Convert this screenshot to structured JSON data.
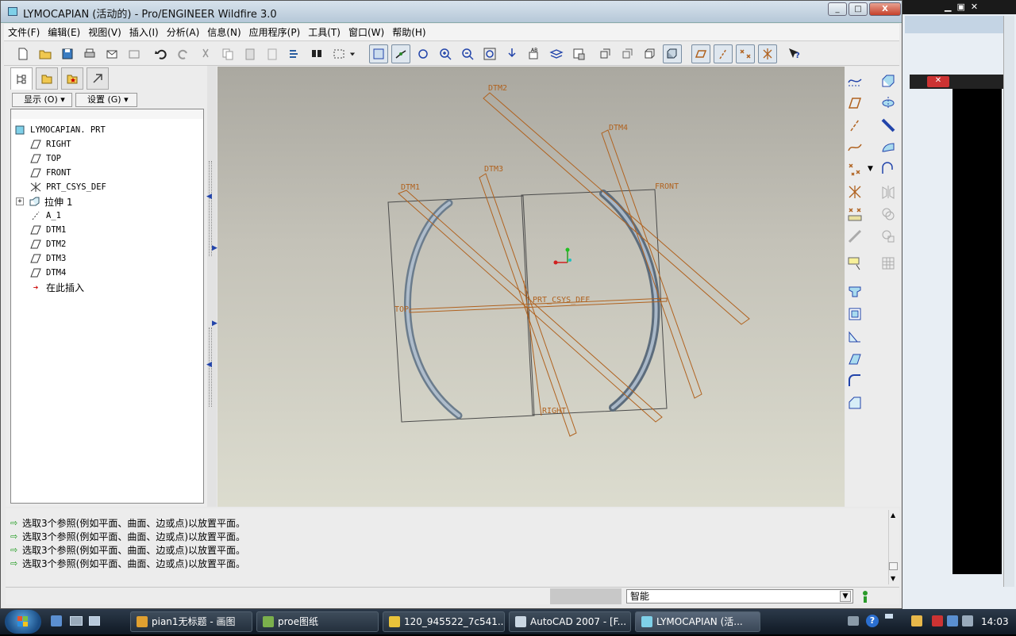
{
  "window": {
    "title": "LYMOCAPIAN (活动的) - Pro/ENGINEER Wildfire 3.0",
    "buttons": [
      "_",
      "□",
      "X"
    ]
  },
  "menu": [
    "文件(F)",
    "编辑(E)",
    "视图(V)",
    "插入(I)",
    "分析(A)",
    "信息(N)",
    "应用程序(P)",
    "工具(T)",
    "窗口(W)",
    "帮助(H)"
  ],
  "left_panel": {
    "show_dropdown": "显示 (O)",
    "settings_dropdown": "设置 (G)",
    "tree": [
      {
        "label": "LYMOCAPIAN. PRT",
        "icon": "part-icon",
        "indent": 0
      },
      {
        "label": "RIGHT",
        "icon": "datum-plane-icon",
        "indent": 1
      },
      {
        "label": "TOP",
        "icon": "datum-plane-icon",
        "indent": 1
      },
      {
        "label": "FRONT",
        "icon": "datum-plane-icon",
        "indent": 1
      },
      {
        "label": "PRT_CSYS_DEF",
        "icon": "csys-icon",
        "indent": 1
      },
      {
        "label": "拉伸 1",
        "icon": "extrude-icon",
        "indent": 1
      },
      {
        "label": "A_1",
        "icon": "axis-icon",
        "indent": 1
      },
      {
        "label": "DTM1",
        "icon": "datum-plane-icon",
        "indent": 1
      },
      {
        "label": "DTM2",
        "icon": "datum-plane-icon",
        "indent": 1
      },
      {
        "label": "DTM3",
        "icon": "datum-plane-icon",
        "indent": 1
      },
      {
        "label": "DTM4",
        "icon": "datum-plane-icon",
        "indent": 1
      },
      {
        "label": "在此插入",
        "icon": "insert-here-icon",
        "indent": 1
      }
    ]
  },
  "viewport": {
    "labels": {
      "dtm2": "DTM2",
      "dtm4": "DTM4",
      "dtm3": "DTM3",
      "dtm1": "DTM1",
      "front": "FRONT",
      "top": "TOP",
      "csys": "PRT_CSYS_DEF",
      "right": "RIGHT"
    },
    "colors": {
      "datum": "#b0621f",
      "frame": "#4a4a4a"
    }
  },
  "messages": [
    "选取3个参照(例如平面、曲面、边或点)以放置平面。",
    "选取3个参照(例如平面、曲面、边或点)以放置平面。",
    "选取3个参照(例如平面、曲面、边或点)以放置平面。",
    "选取3个参照(例如平面、曲面、边或点)以放置平面。"
  ],
  "status": {
    "filter": "智能"
  },
  "taskbar": {
    "tasks": [
      {
        "label": "pian1无标题 - 画图",
        "color": "#e0a030"
      },
      {
        "label": "proe图纸",
        "color": "#7bb04c"
      },
      {
        "label": "120_945522_7c541...",
        "color": "#e9c33a"
      },
      {
        "label": "AutoCAD 2007 - [F...",
        "color": "#c9d6e2"
      },
      {
        "label": "LYMOCAPIAN (活...",
        "color": "#7fd0e8"
      }
    ],
    "clock": "14:03"
  }
}
